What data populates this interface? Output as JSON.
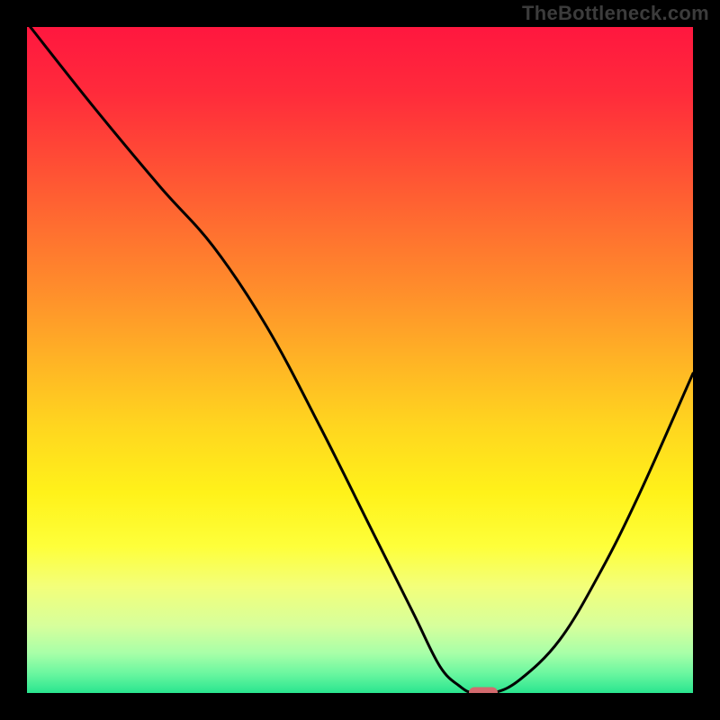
{
  "watermark": "TheBottleneck.com",
  "gradient_stops": [
    {
      "offset": 0.0,
      "color": "#ff173f"
    },
    {
      "offset": 0.1,
      "color": "#ff2b3b"
    },
    {
      "offset": 0.2,
      "color": "#ff4c35"
    },
    {
      "offset": 0.3,
      "color": "#ff6e30"
    },
    {
      "offset": 0.4,
      "color": "#ff8f2b"
    },
    {
      "offset": 0.5,
      "color": "#ffb325"
    },
    {
      "offset": 0.6,
      "color": "#ffd61f"
    },
    {
      "offset": 0.7,
      "color": "#fff21a"
    },
    {
      "offset": 0.78,
      "color": "#feff3a"
    },
    {
      "offset": 0.84,
      "color": "#f3ff7a"
    },
    {
      "offset": 0.9,
      "color": "#d6ff9c"
    },
    {
      "offset": 0.94,
      "color": "#a8ffa8"
    },
    {
      "offset": 0.97,
      "color": "#6cf7a0"
    },
    {
      "offset": 1.0,
      "color": "#29e58f"
    }
  ],
  "chart_data": {
    "type": "line",
    "title": "",
    "xlabel": "",
    "ylabel": "",
    "xlim": [
      0,
      100
    ],
    "ylim": [
      0,
      100
    ],
    "x": [
      0.5,
      10,
      20,
      28,
      36,
      44,
      52,
      58,
      62,
      65,
      67,
      70,
      74,
      80,
      86,
      92,
      100
    ],
    "values": [
      100,
      88,
      76,
      67,
      55,
      40,
      24,
      12,
      4,
      1,
      0,
      0,
      2,
      8,
      18,
      30,
      48
    ],
    "marker": {
      "x": 68.5,
      "y": 0
    }
  }
}
